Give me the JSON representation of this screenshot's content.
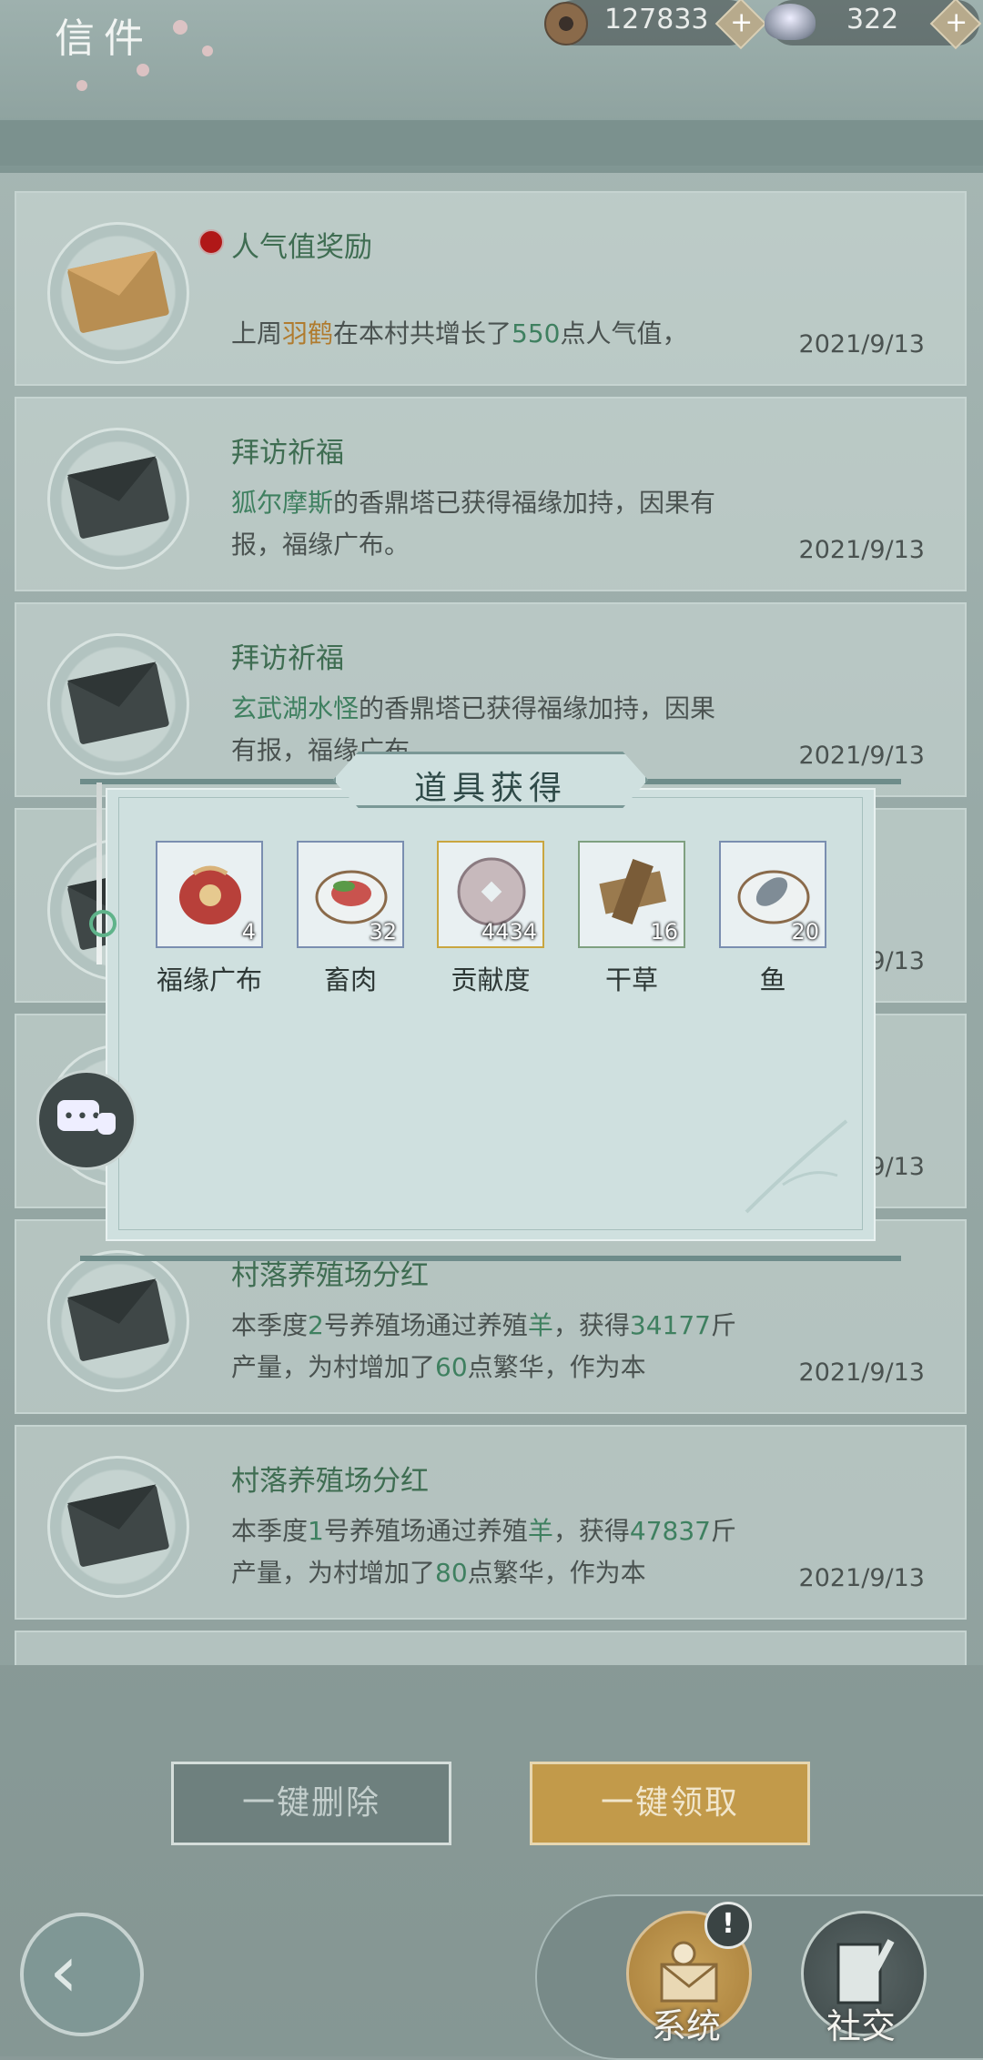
{
  "header": {
    "title": "信件",
    "coins": "127833",
    "ingots": "322",
    "plus": "+"
  },
  "mails": [
    {
      "title": "人气值奖励",
      "unread": true,
      "body_parts": [
        "上周",
        "羽鹤",
        "在本村共增长了",
        "550",
        "点人气值，"
      ],
      "date": "2021/9/13"
    },
    {
      "title": "拜访祈福",
      "body_parts": [
        "狐尔摩斯",
        "的香鼎塔已获得福缘加持，因果有报，福缘广布。"
      ],
      "date": "2021/9/13"
    },
    {
      "title": "拜访祈福",
      "body_parts": [
        "玄武湖水怪",
        "的香鼎塔已获得福缘加持，因果有报，福缘广布"
      ],
      "date": "2021/9/13"
    },
    {
      "title": "",
      "date": "2021/9/13"
    },
    {
      "title": "",
      "date": "2021/9/13"
    },
    {
      "title": "村落养殖场分红",
      "body_parts": [
        "本季度",
        "2",
        "号养殖场通过养殖",
        "羊",
        "，获得",
        "34177",
        "斤产量，为村增加了",
        "60",
        "点繁华，作为本"
      ],
      "date": "2021/9/13"
    },
    {
      "title": "村落养殖场分红",
      "body_parts": [
        "本季度",
        "1",
        "号养殖场通过养殖",
        "羊",
        "，获得",
        "47837",
        "斤产量，为村增加了",
        "80",
        "点繁华，作为本"
      ],
      "date": "2021/9/13"
    }
  ],
  "popup": {
    "title": "道具获得",
    "items": [
      {
        "name": "福缘广布",
        "count": "4",
        "icon": "lucky-bag-icon"
      },
      {
        "name": "畜肉",
        "count": "32",
        "icon": "meat-plate-icon"
      },
      {
        "name": "贡献度",
        "count": "4434",
        "icon": "coin-token-icon"
      },
      {
        "name": "干草",
        "count": "16",
        "icon": "hay-bundle-icon"
      },
      {
        "name": "鱼",
        "count": "20",
        "icon": "fish-plate-icon"
      }
    ]
  },
  "buttons": {
    "delete_all": "一键删除",
    "claim_all": "一键领取"
  },
  "tabs": {
    "system": "系统",
    "social": "社交",
    "alert": "!"
  },
  "colors": {
    "accent_green": "#3f8060",
    "highlight_orange": "#b07b2e",
    "unread_red": "#b01818",
    "claim_gold": "#c29a4a"
  }
}
